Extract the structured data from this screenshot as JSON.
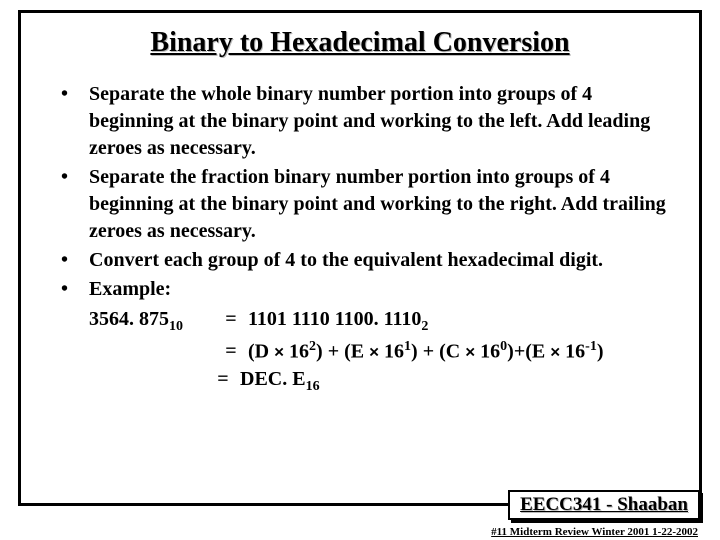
{
  "title": "Binary to Hexadecimal Conversion",
  "bullets": {
    "b1": "Separate the whole binary number portion into groups of 4 beginning at the binary point and working to the left. Add leading zeroes as necessary.",
    "b2": "Separate the fraction binary number portion into groups of 4  beginning at the binary point and working to the right.  Add trailing zeroes as necessary.",
    "b3": "Convert each group of  4  to the equivalent hexadecimal digit.",
    "b4": "Example:"
  },
  "example": {
    "lhs": "3564. 875",
    "lhs_sub": "10",
    "eq": "=",
    "rhs1": "1101 1110 1100. 1110",
    "rhs1_sub": "2",
    "rhs2_D": "(D ",
    "rhs2_E": ") + (E ",
    "rhs2_C": ") + (C ",
    "rhs2_E2": ")+(E ",
    "rhs2_end": ")",
    "base": "16",
    "exp2": "2",
    "exp1": "1",
    "exp0": "0",
    "expm1": "-1",
    "mult": "×",
    "rhs3": "DEC. E",
    "rhs3_sub": "16"
  },
  "footer": {
    "badge": "EECC341 - Shaaban",
    "line": "#11  Midterm Review  Winter 2001  1-22-2002"
  }
}
